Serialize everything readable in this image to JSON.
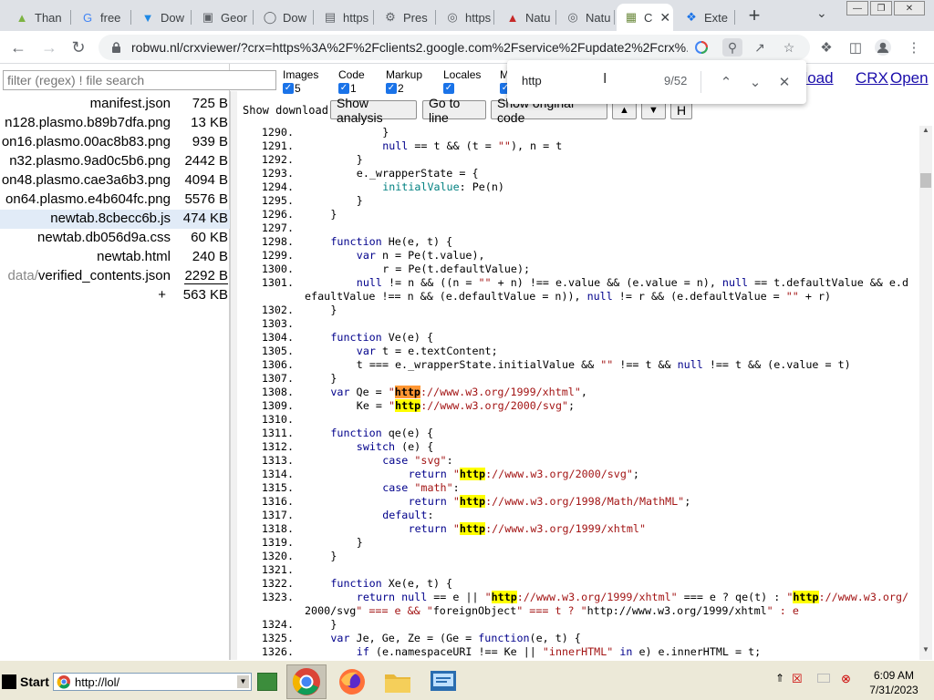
{
  "tabs": [
    {
      "title": "Than",
      "icon": "plasmo-icon"
    },
    {
      "title": "free",
      "icon": "google-icon"
    },
    {
      "title": "Dow",
      "icon": "download-icon"
    },
    {
      "title": "Geor",
      "icon": "dashboard-icon"
    },
    {
      "title": "Dow",
      "icon": "globe-icon"
    },
    {
      "title": "https",
      "icon": "page-icon"
    },
    {
      "title": "Pres",
      "icon": "settings-globe-icon"
    },
    {
      "title": "https",
      "icon": "puzzle-globe-icon"
    },
    {
      "title": "Natu",
      "icon": "nature-icon"
    },
    {
      "title": "Natu",
      "icon": "puzzle-globe-icon"
    },
    {
      "title": "C",
      "icon": "crx-icon"
    },
    {
      "title": "Exte",
      "icon": "extension-icon"
    }
  ],
  "toolbar": {
    "url": "robwu.nl/crxviewer/?crx=https%3A%2F%2Fclients2.google.com%2Fservice%2Fupdate2%2Fcrx%..."
  },
  "filter": {
    "placeholder": "filter (regex) ! file search"
  },
  "files": [
    {
      "name": "manifest.json",
      "size": "725 B"
    },
    {
      "name": "n128.plasmo.b89b7dfa.png",
      "size": "13 KB"
    },
    {
      "name": "on16.plasmo.00ac8b83.png",
      "size": "939 B"
    },
    {
      "name": "n32.plasmo.9ad0c5b6.png",
      "size": "2442 B"
    },
    {
      "name": "on48.plasmo.cae3a6b3.png",
      "size": "4094 B"
    },
    {
      "name": "on64.plasmo.e4b604fc.png",
      "size": "5576 B"
    },
    {
      "name": "newtab.8cbecc6b.js",
      "size": "474 KB"
    },
    {
      "name": "newtab.db056d9a.css",
      "size": "60 KB"
    },
    {
      "name": "newtab.html",
      "size": "240 B"
    },
    {
      "name_prefix": "data/",
      "name": "verified_contents.json",
      "size": "2292 B"
    }
  ],
  "total": {
    "label": "+",
    "size": "563 KB"
  },
  "options": {
    "images": {
      "label": "Images",
      "count": "5"
    },
    "code": {
      "label": "Code",
      "count": "1"
    },
    "markup": {
      "label": "Markup",
      "count": "2"
    },
    "locales": {
      "label": "Locales",
      "count": ""
    },
    "misc": {
      "label": "M",
      "count": ""
    }
  },
  "header_links": {
    "download": "nload",
    "crx": "CRX",
    "open": "Open"
  },
  "actions": {
    "show_download": "Show download",
    "show_analysis": "Show analysis",
    "go_to_line": "Go to line",
    "show_original": "Show original code",
    "up": "▲",
    "down": "▼",
    "h": "H"
  },
  "find": {
    "query": "http",
    "count": "9/52"
  },
  "code_lines": [
    {
      "n": "1290.",
      "i": 3,
      "t": "}"
    },
    {
      "n": "1291.",
      "i": 3,
      "t": "null == t && (t = \"\"), n = t"
    },
    {
      "n": "1292.",
      "i": 2,
      "t": "}"
    },
    {
      "n": "1293.",
      "i": 2,
      "t": "e._wrapperState = {"
    },
    {
      "n": "1294.",
      "i": 3,
      "t": "initialValue: Pe(n)"
    },
    {
      "n": "1295.",
      "i": 2,
      "t": "}"
    },
    {
      "n": "1296.",
      "i": 1,
      "t": "}"
    },
    {
      "n": "1297.",
      "i": 0,
      "t": ""
    },
    {
      "n": "1298.",
      "i": 1,
      "t": "function He(e, t) {"
    },
    {
      "n": "1299.",
      "i": 2,
      "t": "var n = Pe(t.value),"
    },
    {
      "n": "1300.",
      "i": 3,
      "t": "r = Pe(t.defaultValue);"
    },
    {
      "n": "1301.",
      "i": 2,
      "t": "null != n && ((n = \"\" + n) !== e.value && (e.value = n), null == t.defaultValue && e.d"
    },
    {
      "n": "",
      "i": 0,
      "t": "efaultValue !== n && (e.defaultValue = n)), null != r && (e.defaultValue = \"\" + r)"
    },
    {
      "n": "1302.",
      "i": 1,
      "t": "}"
    },
    {
      "n": "1303.",
      "i": 0,
      "t": ""
    },
    {
      "n": "1304.",
      "i": 1,
      "t": "function Ve(e) {"
    },
    {
      "n": "1305.",
      "i": 2,
      "t": "var t = e.textContent;"
    },
    {
      "n": "1306.",
      "i": 2,
      "t": "t === e._wrapperState.initialValue && \"\" !== t && null !== t && (e.value = t)"
    },
    {
      "n": "1307.",
      "i": 1,
      "t": "}"
    },
    {
      "n": "1308.",
      "i": 1,
      "t": "var Qe = \"http://www.w3.org/1999/xhtml\","
    },
    {
      "n": "1309.",
      "i": 2,
      "t": "Ke = \"http://www.w3.org/2000/svg\";"
    },
    {
      "n": "1310.",
      "i": 0,
      "t": ""
    },
    {
      "n": "1311.",
      "i": 1,
      "t": "function qe(e) {"
    },
    {
      "n": "1312.",
      "i": 2,
      "t": "switch (e) {"
    },
    {
      "n": "1313.",
      "i": 3,
      "t": "case \"svg\":"
    },
    {
      "n": "1314.",
      "i": 4,
      "t": "return \"http://www.w3.org/2000/svg\";"
    },
    {
      "n": "1315.",
      "i": 3,
      "t": "case \"math\":"
    },
    {
      "n": "1316.",
      "i": 4,
      "t": "return \"http://www.w3.org/1998/Math/MathML\";"
    },
    {
      "n": "1317.",
      "i": 3,
      "t": "default:"
    },
    {
      "n": "1318.",
      "i": 4,
      "t": "return \"http://www.w3.org/1999/xhtml\""
    },
    {
      "n": "1319.",
      "i": 2,
      "t": "}"
    },
    {
      "n": "1320.",
      "i": 1,
      "t": "}"
    },
    {
      "n": "1321.",
      "i": 0,
      "t": ""
    },
    {
      "n": "1322.",
      "i": 1,
      "t": "function Xe(e, t) {"
    },
    {
      "n": "1323.",
      "i": 2,
      "t": "return null == e || \"http://www.w3.org/1999/xhtml\" === e ? qe(t) : \"http://www.w3.org/"
    },
    {
      "n": "",
      "i": 0,
      "t": "2000/svg\" === e && \"foreignObject\" === t ? \"http://www.w3.org/1999/xhtml\" : e"
    },
    {
      "n": "1324.",
      "i": 1,
      "t": "}"
    },
    {
      "n": "1325.",
      "i": 1,
      "t": "var Je, Ge, Ze = (Ge = function(e, t) {"
    },
    {
      "n": "1326.",
      "i": 2,
      "t": "if (e.namespaceURI !== Ke || \"innerHTML\" in e) e.innerHTML = t;"
    }
  ],
  "current_match_line": "1308.",
  "taskbar": {
    "start": "Start",
    "address": "http://lol/",
    "time": "6:09 AM",
    "date": "7/31/2023"
  },
  "colors": {
    "accent": "#1a73e8",
    "highlight": "#ffff00",
    "current_highlight": "#ff9632",
    "keyword": "#00008b",
    "string": "#a31515",
    "link": "#1a0dab"
  }
}
